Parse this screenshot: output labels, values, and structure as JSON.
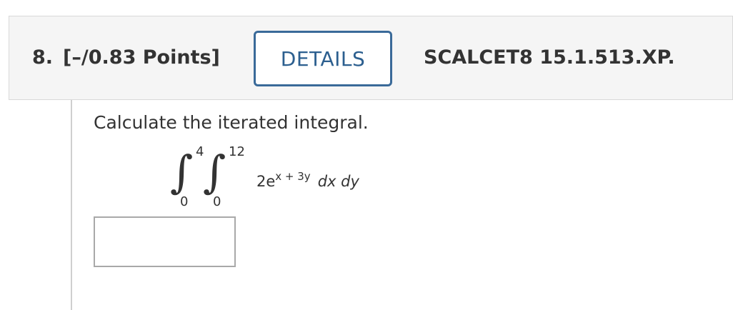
{
  "question": {
    "number": "8.",
    "points": "[–/0.83 Points]",
    "details_label": "DETAILS",
    "code": "SCALCET8 15.1.513.XP."
  },
  "problem": {
    "prompt": "Calculate the iterated integral.",
    "integral": {
      "outer_upper": "4",
      "outer_lower": "0",
      "inner_upper": "12",
      "inner_lower": "0",
      "coefficient": "2e",
      "exponent": "x + 3y",
      "differentials": "dx dy"
    }
  },
  "answer": {
    "value": "",
    "placeholder": ""
  }
}
